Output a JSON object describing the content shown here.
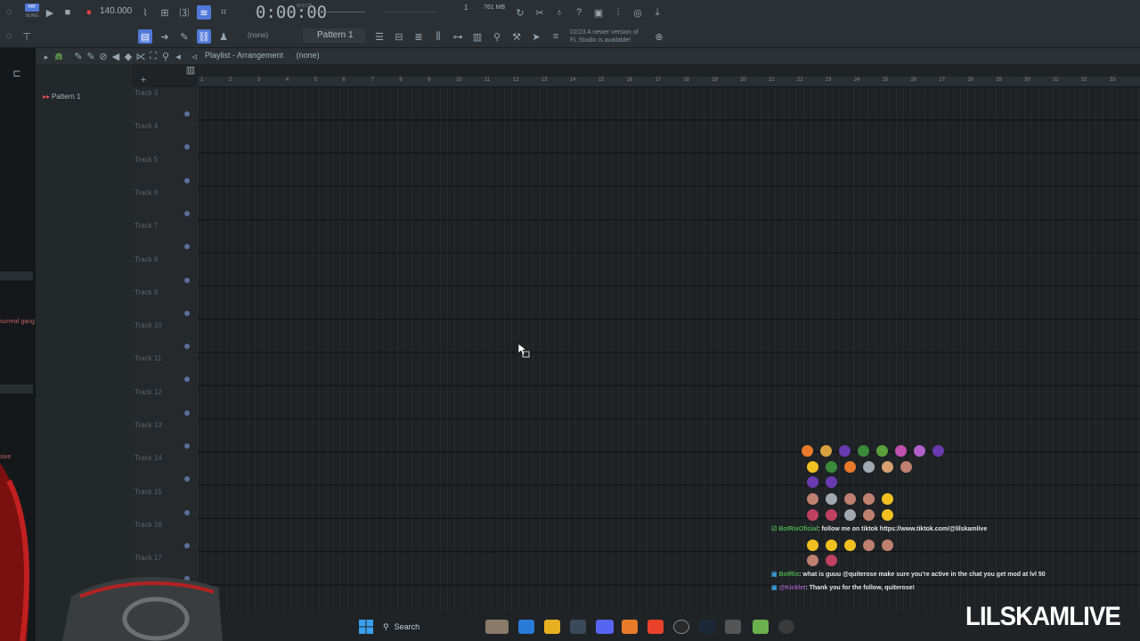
{
  "toolbar": {
    "pat_label": "PAT",
    "song_label": "SONG",
    "tempo": "140.000",
    "time": "0:00:00",
    "time_unit": "M:S:CS",
    "cpu": "1",
    "memory": "761 MB",
    "pattern_selector": "Pattern 1",
    "none_selector": "(none)",
    "news_line1": "02/23 A newer version of",
    "news_line2": "FL Studio is available!"
  },
  "playlist": {
    "title": "Playlist - Arrangement",
    "title_suffix": "(none)",
    "pattern_list": [
      "Pattern 1"
    ],
    "ruler": [
      "1",
      "2",
      "3",
      "4",
      "5",
      "6",
      "7",
      "8",
      "9",
      "10",
      "11",
      "12",
      "13",
      "14",
      "15",
      "16",
      "17",
      "18",
      "19",
      "20",
      "21",
      "22",
      "23",
      "24",
      "25",
      "26",
      "27",
      "28",
      "29",
      "30",
      "31",
      "32",
      "33"
    ],
    "tracks": [
      "Track 3",
      "Track 4",
      "Track 5",
      "Track 6",
      "Track 7",
      "Track 8",
      "Track 9",
      "Track 10",
      "Track 11",
      "Track 12",
      "Track 13",
      "Track 14",
      "Track 15",
      "Track 16",
      "Track 17"
    ]
  },
  "side": {
    "text1": "surreal gang",
    "text2": "sive"
  },
  "chat": {
    "msg1_user": "BotRixOficial",
    "msg1_text": ": follow me on tiktok https://www.tiktok.com/@lilskamlive",
    "msg2_user": "BotRix",
    "msg2_text": ": what is guuu @quiterose make sure you're active in the chat you get mod at lvl 50",
    "msg3_user": "@Kicklet",
    "msg3_text": ": Thank you for the follow, quiterose!"
  },
  "taskbar": {
    "search_label": "Search"
  },
  "overlay": {
    "brand": "LILSKAMLIVE"
  },
  "colors": {
    "accent": "#5078d8",
    "background": "#1e2225"
  }
}
